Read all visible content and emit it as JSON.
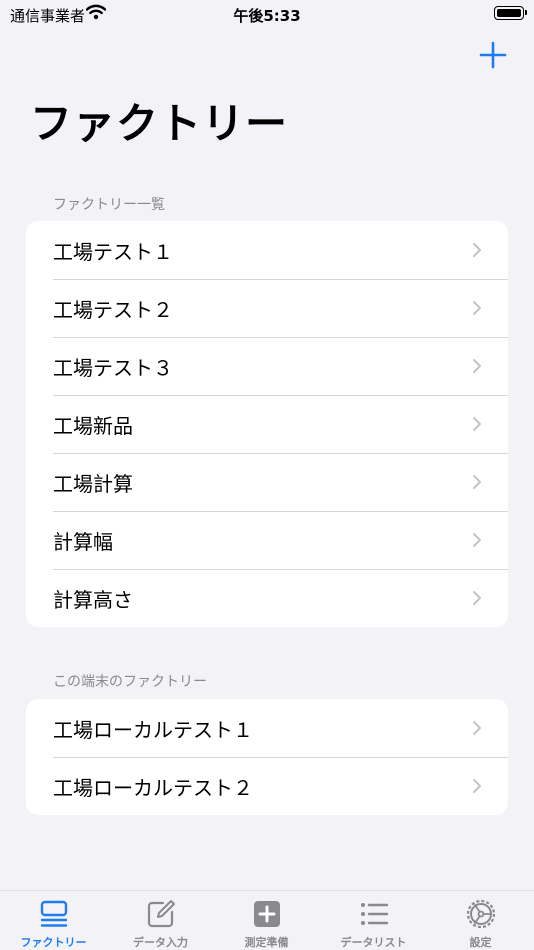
{
  "status_bar": {
    "carrier": "通信事業者",
    "time": "午後5:33"
  },
  "page_title": "ファクトリー",
  "sections": [
    {
      "header": "ファクトリー一覧",
      "items": [
        "工場テスト１",
        "工場テスト２",
        "工場テスト３",
        "工場新品",
        "工場計算",
        "計算幅",
        "計算高さ"
      ]
    },
    {
      "header": "この端末のファクトリー",
      "items": [
        "工場ローカルテスト１",
        "工場ローカルテスト２"
      ]
    }
  ],
  "tabs": [
    {
      "label": "ファクトリー",
      "icon": "factory-list-icon",
      "active": true
    },
    {
      "label": "データ入力",
      "icon": "edit-icon",
      "active": false
    },
    {
      "label": "測定準備",
      "icon": "plus-square-icon",
      "active": false
    },
    {
      "label": "データリスト",
      "icon": "list-icon",
      "active": false
    },
    {
      "label": "設定",
      "icon": "gear-icon",
      "active": false
    }
  ],
  "colors": {
    "accent": "#1e7cf0",
    "inactive": "#8a8a8e",
    "background": "#f2f2f7"
  }
}
